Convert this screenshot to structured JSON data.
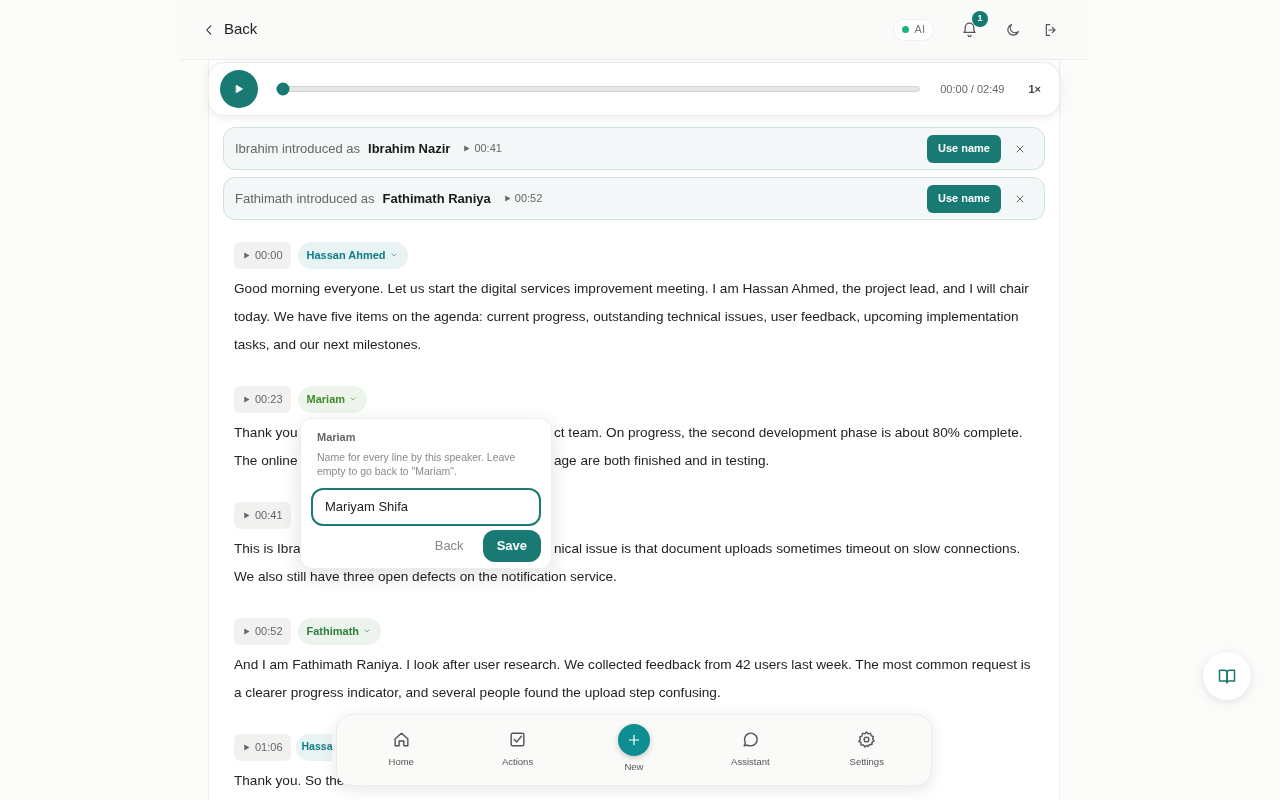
{
  "header": {
    "back": "Back",
    "ai": {
      "label": "AI",
      "on": true
    },
    "notifications": "1"
  },
  "player": {
    "time": "00:00 / 02:49",
    "speed": "1×",
    "level": 0
  },
  "suggestions": [
    {
      "prefix": "Ibrahim introduced as",
      "name": "Ibrahim Nazir",
      "time": "00:41",
      "action": "Use name"
    },
    {
      "prefix": "Fathimath introduced as",
      "name": "Fathimath Raniya",
      "time": "00:52",
      "action": "Use name"
    }
  ],
  "segments": [
    {
      "time": "00:00",
      "speaker": {
        "name": "Hassan Ahmed",
        "color": "#0e7c86"
      },
      "text": "Good morning everyone. Let us start the digital services improvement meeting. I am Hassan Ahmed, the project lead, and I will chair today. We have five items on the agenda: current progress, outstanding technical issues, user feedback, upcoming implementation tasks, and our next milestones."
    },
    {
      "time": "00:23",
      "speaker": {
        "name": "Mariam",
        "color": "#3d8a2a"
      },
      "lines": [
        [
          "Thank you",
          "ct team. On progress, the second development phase is about 80% complete."
        ],
        [
          "The online",
          "age are both finished and in testing."
        ]
      ]
    },
    {
      "time": "00:41",
      "lines": [
        [
          "This is Ibra",
          "nical issue is that document uploads sometimes timeout on slow connections."
        ],
        [
          "We also still have three open defects on the notification service."
        ]
      ]
    },
    {
      "time": "00:52",
      "speaker": {
        "name": "Fathimath",
        "color": "#2f7d3a"
      },
      "text": "And I am Fathimath Raniya. I look after user research. We collected feedback from 42 users last week. The most common request is a clearer progress indicator, and several people found the upload step confusing."
    },
    {
      "time": "01:06",
      "speaker": {
        "name": "Hassa",
        "color": "#0e7c86"
      },
      "lines": [
        [
          "Thank you. So the"
        ]
      ]
    }
  ],
  "popover": {
    "title": "Mariam",
    "help": "Name for every line by this speaker. Leave empty to go back to \"Mariam\".",
    "value": "Mariyam Shifa",
    "cancel": "Back",
    "save": "Save"
  },
  "nav": [
    {
      "label": "Home",
      "kind": "home"
    },
    {
      "label": "Actions",
      "kind": "actions"
    },
    {
      "label": "New",
      "kind": "new"
    },
    {
      "label": "Assistant",
      "kind": "assistant"
    },
    {
      "label": "Settings",
      "kind": "settings"
    }
  ]
}
